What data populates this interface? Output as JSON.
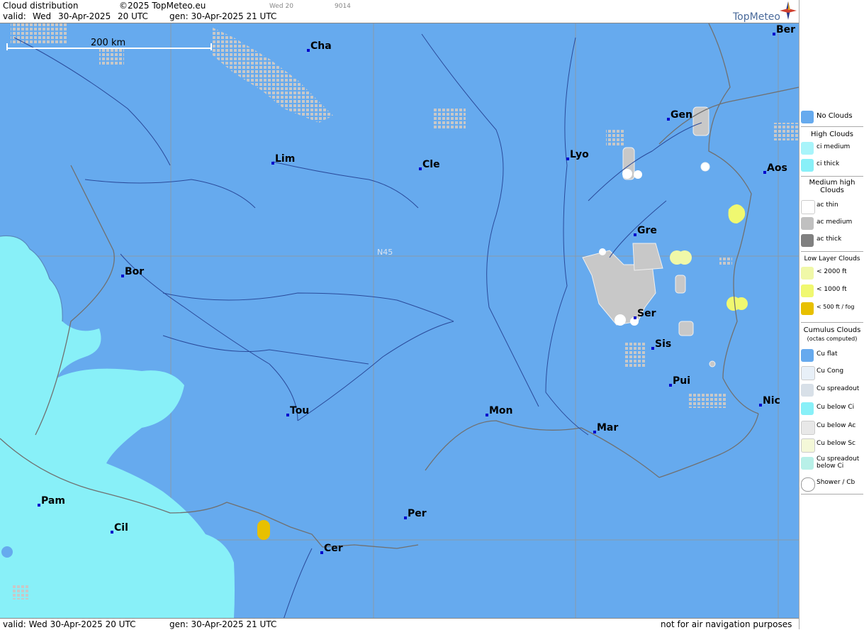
{
  "header": {
    "product": "Cloud distribution",
    "copyright": "©2025 TopMeteo.eu",
    "valid_label": "valid:",
    "valid_day": "Wed",
    "valid_date": "30-Apr-2025",
    "valid_time": "20 UTC",
    "gen": "gen: 30-Apr-2025 21 UTC",
    "small_code1": "Wed 20",
    "small_code2": "9014",
    "brand": "TopMeteo"
  },
  "footer": {
    "valid": "valid:  Wed  30-Apr-2025  20 UTC",
    "gen": "gen: 30-Apr-2025 21 UTC",
    "disclaimer": "not for air navigation purposes"
  },
  "map": {
    "scale_label": "200 km",
    "lat_label": "N45",
    "cities": [
      {
        "label": "Ber"
      },
      {
        "label": "Cha"
      },
      {
        "label": "Gen"
      },
      {
        "label": "Lim"
      },
      {
        "label": "Cle"
      },
      {
        "label": "Lyo"
      },
      {
        "label": "Aos"
      },
      {
        "label": "Gre"
      },
      {
        "label": "Bor"
      },
      {
        "label": "Ser"
      },
      {
        "label": "Sis"
      },
      {
        "label": "Pui"
      },
      {
        "label": "Nic"
      },
      {
        "label": "Tou"
      },
      {
        "label": "Mon"
      },
      {
        "label": "Mar"
      },
      {
        "label": "Pam"
      },
      {
        "label": "Cil"
      },
      {
        "label": "Per"
      },
      {
        "label": "Cer"
      }
    ],
    "colors": {
      "sea_land": "#66aaee",
      "cirrus": "#88f0f8",
      "ac_medium": "#c8c8c8",
      "low_2000": "#f0f8a8",
      "low_1000": "#f0f870",
      "fog": "#e8c000",
      "border": "#707070",
      "river": "#2a4a9a"
    }
  },
  "legend": {
    "no_clouds": "No Clouds",
    "high_clouds": "High Clouds",
    "ci_medium": "ci medium",
    "ci_thick": "ci thick",
    "medium_high": "Medium high Clouds",
    "ac_thin": "ac thin",
    "ac_medium": "ac medium",
    "ac_thick": "ac thick",
    "low_layer": "Low Layer Clouds",
    "lt2000": "< 2000 ft",
    "lt1000": "< 1000 ft",
    "lt500": "< 500 ft / fog",
    "cumulus": "Cumulus Clouds",
    "octas": "(octas computed)",
    "cu_flat": "Cu flat",
    "cu_cong": "Cu Cong",
    "cu_spread": "Cu spreadout",
    "cu_below_ci": "Cu below Ci",
    "cu_below_ac": "Cu below Ac",
    "cu_below_sc": "Cu below Sc",
    "cu_spread_below_ci": "Cu spreadout below Ci",
    "shower": "Shower / Cb"
  }
}
